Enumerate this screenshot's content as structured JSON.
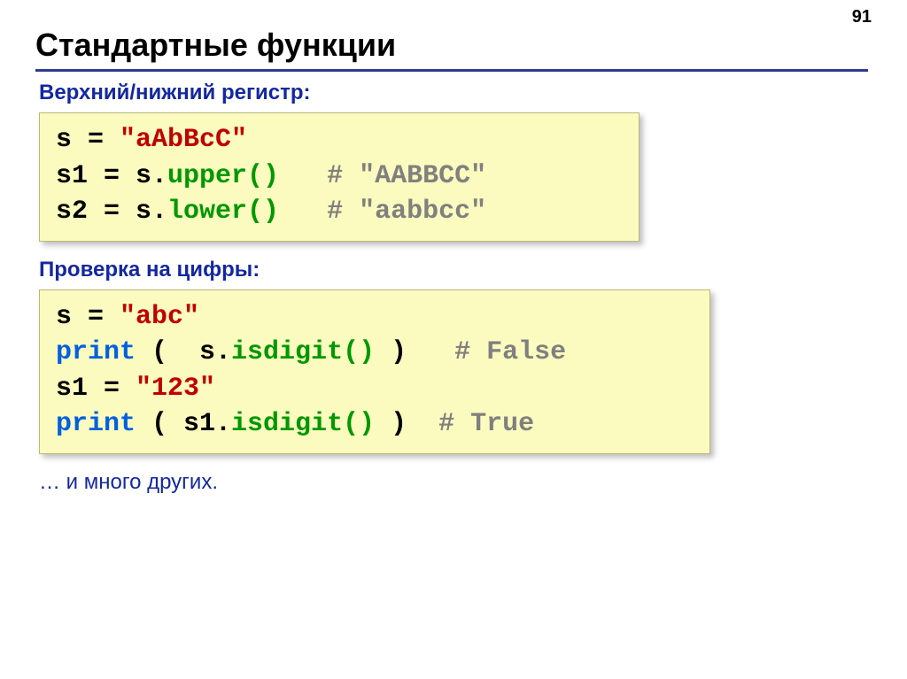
{
  "page_number": "91",
  "title": "Стандартные функции",
  "section1_label": "Верхний/нижний регистр:",
  "section2_label": "Проверка на цифры:",
  "trailer": "… и много других.",
  "code1": {
    "l1": {
      "lhs": "s = ",
      "str": "\"aAbBcC\""
    },
    "l2": {
      "lhs": "s1 = s.",
      "fn": "upper()",
      "pad": "   ",
      "comment": "# \"AABBCC\""
    },
    "l3": {
      "lhs": "s2 = s.",
      "fn": "lower()",
      "pad": "   ",
      "comment": "# \"aabbcc\""
    }
  },
  "code2": {
    "l1": {
      "lhs": "s = ",
      "str": "\"abc\""
    },
    "l2": {
      "kw": "print",
      "open": " (  s.",
      "fn": "isdigit()",
      "close": " )   ",
      "comment": "# False"
    },
    "l3": {
      "lhs": "s1 = ",
      "str": "\"123\""
    },
    "l4": {
      "kw": "print",
      "open": " ( s1.",
      "fn": "isdigit()",
      "close": " )  ",
      "comment": "# True"
    }
  }
}
